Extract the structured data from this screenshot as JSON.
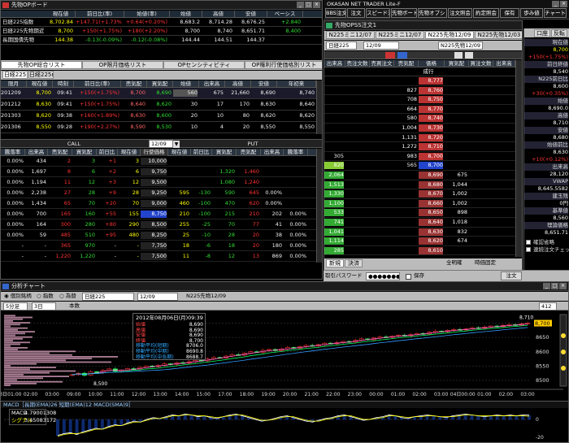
{
  "sakimono_board": {
    "title": "先物OPボード",
    "header": [
      "現在値",
      "前日比(率)",
      "始値(率)",
      "始値",
      "高値",
      "安値",
      "ベーシス"
    ],
    "rows": [
      {
        "name": "日経225指数",
        "v": [
          "8,702.84",
          "+147.71(+1.73%)",
          "+0.64(+0.20%)",
          "8,683.2",
          "8,714.28",
          "8,676.25",
          "+2.840"
        ]
      },
      {
        "name": "日経225先物期近",
        "v": [
          "8,700",
          "+150(+1.75%)",
          "+180(+2.20%)",
          "8,700",
          "8,740",
          "8,651.71",
          "8,400"
        ]
      },
      {
        "name": "長期国債先物",
        "v": [
          "144.38",
          "-0.13(-0.09%)",
          "-0.12(-0.08%)",
          "144.44",
          "144.51",
          "144.37",
          ""
        ]
      }
    ],
    "tabs": [
      "先物OP総合リスト",
      "OP限月価格リスト",
      "OPセンシティビティ",
      "OP権利行使価格別リスト"
    ],
    "subtabs": [
      "日経225",
      "日経225mini"
    ],
    "futures_header": [
      "限月",
      "現在値",
      "時刻",
      "前日比(率)",
      "売気配",
      "買気配",
      "始値",
      "出来高",
      "高値",
      "安値",
      "年初来"
    ],
    "futures": [
      [
        "201209",
        "8,700",
        "09:41",
        "+150(+1.75%)",
        "8,700",
        "8,690",
        "560",
        "675",
        "21,660",
        "8,690",
        "8,740"
      ],
      [
        "201212",
        "8,630",
        "09:41",
        "+150(+1.75%)",
        "8,640",
        "8,620",
        "30",
        "17",
        "170",
        "8,630",
        "8,640"
      ],
      [
        "201303",
        "8,620",
        "09:38",
        "+160(+1.89%)",
        "8,630",
        "8,600",
        "20",
        "10",
        "80",
        "8,620",
        "8,620"
      ],
      [
        "201306",
        "8,550",
        "09:28",
        "+190(+2.27%)",
        "8,590",
        "8,530",
        "10",
        "4",
        "20",
        "8,550",
        "8,550"
      ]
    ],
    "call_label": "CALL",
    "put_label": "PUT",
    "month": "12/09",
    "opt_header": [
      "騰落率",
      "出来高",
      "売気配",
      "買気配",
      "前日比",
      "現在値",
      "行使価格",
      "現在値",
      "前日比",
      "買気配",
      "売気配",
      "出来高",
      "騰落率"
    ],
    "options": [
      [
        "0.00%",
        "434",
        "2",
        "3",
        "+1",
        "3",
        "10,000",
        "",
        "",
        "",
        "",
        "",
        ""
      ],
      [
        "0.00%",
        "1,697",
        "8",
        "6",
        "+2",
        "6",
        "9,750",
        "",
        "",
        "1,320",
        "1,460",
        "",
        ""
      ],
      [
        "0.00%",
        "1,194",
        "11",
        "12",
        "+3",
        "12",
        "9,500",
        "",
        "",
        "1,080",
        "1,240",
        "",
        ""
      ],
      [
        "0.00%",
        "2,238",
        "27",
        "28",
        "+9",
        "28",
        "9,250",
        "595",
        "-130",
        "590",
        "645",
        "0.00%",
        ""
      ],
      [
        "0.00%",
        "1,434",
        "65",
        "70",
        "+20",
        "70",
        "9,000",
        "460",
        "-100",
        "470",
        "620",
        "0.00%",
        ""
      ],
      [
        "0.00%",
        "700",
        "165",
        "160",
        "+55",
        "155",
        "8,750",
        "210",
        "-100",
        "215",
        "210",
        "202",
        "0.00%"
      ],
      [
        "0.00%",
        "164",
        "300",
        "280",
        "+80",
        "290",
        "8,500",
        "255",
        "-25",
        "70",
        "77",
        "41",
        "0.00%"
      ],
      [
        "0.00%",
        "59",
        "485",
        "510",
        "+95",
        "480",
        "8,250",
        "25",
        "-10",
        "28",
        "20",
        "38",
        "0.00%"
      ],
      [
        "-",
        "-",
        "365",
        "970",
        "-",
        "-",
        "7,750",
        "18",
        "-6",
        "18",
        "20",
        "180",
        "0.00%"
      ],
      [
        "-",
        "-",
        "1,220",
        "1,220",
        "-",
        "-",
        "7,500",
        "11",
        "-8",
        "12",
        "13",
        "869",
        "0.00%"
      ]
    ]
  },
  "toolbar": {
    "app_title": "OKASAN NET TRADER Lite-F",
    "buttons": [
      "BBS注文",
      "注文",
      "スピード注文",
      "先物ボード",
      "先物オプション",
      "注文照会",
      "約定照会",
      "保有",
      "歩み値",
      "チャート"
    ]
  },
  "speed_order": {
    "title": "先物OPSS注文1",
    "tabs": [
      "N225ミニ12/07",
      "N225ミニ12/07",
      "N225先物12/09",
      "N225先物12/03"
    ],
    "product": "日経225",
    "month": "12/09",
    "product_label": "N225先物12/09",
    "buttons": [
      "口座",
      "反転"
    ],
    "header": [
      "出来高",
      "売注文数",
      "売買注文",
      "売気配",
      "価格",
      "買気配",
      "買注文数",
      "出来高"
    ],
    "market_label": "成行",
    "ladder": [
      [
        "",
        "",
        "",
        "",
        "8,777",
        "",
        "",
        ""
      ],
      [
        "",
        "",
        "",
        "827",
        "8,760",
        "",
        "",
        ""
      ],
      [
        "",
        "",
        "",
        "708",
        "8,750",
        "",
        "",
        ""
      ],
      [
        "",
        "",
        "",
        "664",
        "8,770",
        "",
        "",
        ""
      ],
      [
        "",
        "",
        "",
        "580",
        "8,740",
        "",
        "",
        ""
      ],
      [
        "",
        "",
        "",
        "1,004",
        "8,730",
        "",
        "",
        ""
      ],
      [
        "",
        "",
        "",
        "1,131",
        "8,720",
        "",
        "",
        ""
      ],
      [
        "",
        "",
        "",
        "1,272",
        "8,710",
        "",
        "",
        ""
      ],
      [
        "305",
        "",
        "",
        "983",
        "8,700",
        "",
        "",
        ""
      ],
      [
        "820",
        "",
        "",
        "565",
        "8,700",
        "",
        "",
        ""
      ],
      [
        "2,064",
        "",
        "",
        "",
        "8,690",
        "675",
        "",
        ""
      ],
      [
        "1,513",
        "",
        "",
        "",
        "8,680",
        "1,044",
        "",
        ""
      ],
      [
        "1,330",
        "",
        "",
        "",
        "8,670",
        "1,002",
        "",
        ""
      ],
      [
        "1,100",
        "",
        "",
        "",
        "8,660",
        "1,002",
        "",
        ""
      ],
      [
        "533",
        "",
        "",
        "",
        "8,650",
        "898",
        "",
        ""
      ],
      [
        "741",
        "",
        "",
        "",
        "8,640",
        "1,018",
        "",
        ""
      ],
      [
        "1,041",
        "",
        "",
        "",
        "8,630",
        "832",
        "",
        ""
      ],
      [
        "1,114",
        "",
        "",
        "",
        "8,620",
        "674",
        "",
        ""
      ],
      [
        "285",
        "",
        "",
        "",
        "8,610",
        "",
        "",
        ""
      ]
    ],
    "bottom_tabs": [
      "新規",
      "決済"
    ],
    "bottom_opts": [
      "全明確",
      "時価固定"
    ],
    "pw_label": "取引パスワード",
    "pw_value": "●●●●●●●●",
    "save_label": "保存",
    "order_btn": "注文"
  },
  "side_panel": {
    "items": [
      {
        "label": "現在値",
        "value": "8,700",
        "cls": "yel"
      },
      {
        "label": "",
        "value": "+150(+1.75%)",
        "cls": "red"
      },
      {
        "label": "前日終値",
        "value": "8,540",
        "cls": "wht"
      },
      {
        "label": "N225前日比",
        "value": "8,600",
        "cls": "wht"
      },
      {
        "label": "",
        "value": "+30(+0.35%)",
        "cls": "red"
      },
      {
        "label": "始値",
        "value": "8,690.0",
        "cls": "wht"
      },
      {
        "label": "高値",
        "value": "8,710",
        "cls": "wht"
      },
      {
        "label": "安値",
        "value": "8,680",
        "cls": "wht"
      },
      {
        "label": "始値前比",
        "value": "8,630",
        "cls": "wht"
      },
      {
        "label": "",
        "value": "+10(+0.12%)",
        "cls": "red"
      },
      {
        "label": "出来高",
        "value": "28,120",
        "cls": "wht"
      },
      {
        "label": "VWAP",
        "value": "8,645.5582",
        "cls": "wht"
      },
      {
        "label": "建玉残",
        "value": "0円",
        "cls": "wht"
      },
      {
        "label": "基準値",
        "value": "8,560",
        "cls": "wht"
      },
      {
        "label": "理論価格",
        "value": "8,651.71",
        "cls": "wht"
      }
    ],
    "checks": [
      "確認省略",
      "連続注文チェック"
    ]
  },
  "chart_win": {
    "title": "分析チャート",
    "radio": [
      "個別銘柄",
      "指数",
      "為替"
    ],
    "index": "日経225",
    "month": "12/09",
    "symbol": "N225先物12/09",
    "period": "5分足",
    "range": "3日",
    "option": "本数",
    "count": "412",
    "legend": {
      "date": "2012年08月06日(月)09:39",
      "rows": [
        {
          "k": "始値",
          "v": "8,690",
          "c": "#ff4444"
        },
        {
          "k": "高値",
          "v": "8,690",
          "c": "#ff4444"
        },
        {
          "k": "安値",
          "v": "8,690",
          "c": "#ff4444"
        },
        {
          "k": "終値",
          "v": "8,700",
          "c": "#ff4444"
        },
        {
          "k": "移動平均(短期)",
          "v": "8706.0",
          "c": "#33aaff"
        },
        {
          "k": "移動平均(中期)",
          "v": "8690.8",
          "c": "#33aaff"
        },
        {
          "k": "移動平均(中長期)",
          "v": "8688.7",
          "c": "#33aaff"
        }
      ]
    },
    "price_ticks": [
      "8650",
      "8600",
      "8550",
      "8500"
    ],
    "high_mark": "8,710",
    "last_price": "8,700",
    "low_mark": "8,500",
    "time_labels": [
      "03日01:00",
      "02:00",
      "03:00",
      "09:00",
      "10:00",
      "11:00",
      "12:00",
      "13:00",
      "14:00",
      "15:00",
      "17:00",
      "18:00",
      "19:00",
      "20:00",
      "21:00",
      "22:00",
      "23:00",
      "00:00",
      "01:00",
      "02:00",
      "03:00",
      "04日00:00",
      "01:00",
      "02:00",
      "03:00"
    ],
    "macd_label": "MACD［長期(EMA)26 短期(EMA)12 MACD(SMA)9］",
    "macd_k": "MACD",
    "macd_v": "4.79001308",
    "signal_k": "シグナル",
    "signal_v": "3.45083172",
    "macd_ticks": [
      "0",
      "-20"
    ],
    "colors": {
      "up": "#ff3333",
      "down": "#33ff66",
      "ma_short": "#ff66cc",
      "ma_mid": "#00ff66",
      "ma_long": "#3399ff"
    }
  },
  "chart_data": {
    "type": "candlestick",
    "title": "",
    "x_unit": "5min",
    "ylim": [
      8480,
      8730
    ],
    "close_series": [
      8520,
      8525,
      8518,
      8530,
      8528,
      8535,
      8540,
      8532,
      8536,
      8541,
      8538,
      8545,
      8550,
      8548,
      8552,
      8558,
      8556,
      8562,
      8560,
      8565,
      8570,
      8568,
      8575,
      8580,
      8578,
      8585,
      8590,
      8588,
      8595,
      8600,
      8598,
      8605,
      8608,
      8604,
      8610,
      8615,
      8612,
      8618,
      8622,
      8620,
      8625,
      8630,
      8628,
      8632,
      8636,
      8634,
      8640,
      8645,
      8642,
      8648,
      8652,
      8650,
      8655,
      8658,
      8656,
      8660,
      8664,
      8662,
      8668,
      8672,
      8670,
      8675,
      8678,
      8676,
      8680,
      8684,
      8682,
      8686,
      8690,
      8688,
      8692,
      8695,
      8693,
      8698,
      8700
    ],
    "macd_series": [
      -18,
      -16,
      -15,
      -17,
      -14,
      -12,
      -10,
      -11,
      -8,
      -6,
      -7,
      -4,
      -2,
      -3,
      0,
      2,
      1,
      3,
      5,
      4,
      6,
      5,
      3,
      4,
      2,
      1,
      3,
      5,
      6,
      4,
      2,
      0,
      -2,
      -1,
      1,
      3,
      4,
      2,
      0,
      -2,
      -3,
      -1,
      1,
      2,
      4,
      5,
      3,
      1,
      -1,
      0,
      2,
      3,
      5,
      4,
      2,
      1,
      3,
      4,
      5,
      4,
      3,
      2,
      4,
      5,
      6,
      5,
      4,
      3,
      4,
      5,
      4,
      5,
      4,
      5,
      4.8
    ],
    "signal_series": [
      -19,
      -17,
      -16,
      -16,
      -15,
      -13,
      -11,
      -11,
      -9,
      -7,
      -7,
      -5,
      -3,
      -3,
      -1,
      1,
      1,
      2,
      4,
      4,
      5,
      5,
      4,
      4,
      3,
      2,
      3,
      4,
      5,
      5,
      3,
      1,
      -1,
      -1,
      0,
      2,
      3,
      3,
      1,
      -1,
      -2,
      -2,
      0,
      1,
      3,
      4,
      4,
      2,
      0,
      0,
      1,
      2,
      4,
      4,
      3,
      2,
      3,
      3,
      4,
      4,
      3,
      3,
      3,
      4,
      5,
      5,
      4,
      4,
      4,
      4,
      4,
      4,
      4,
      4,
      3.5
    ]
  }
}
